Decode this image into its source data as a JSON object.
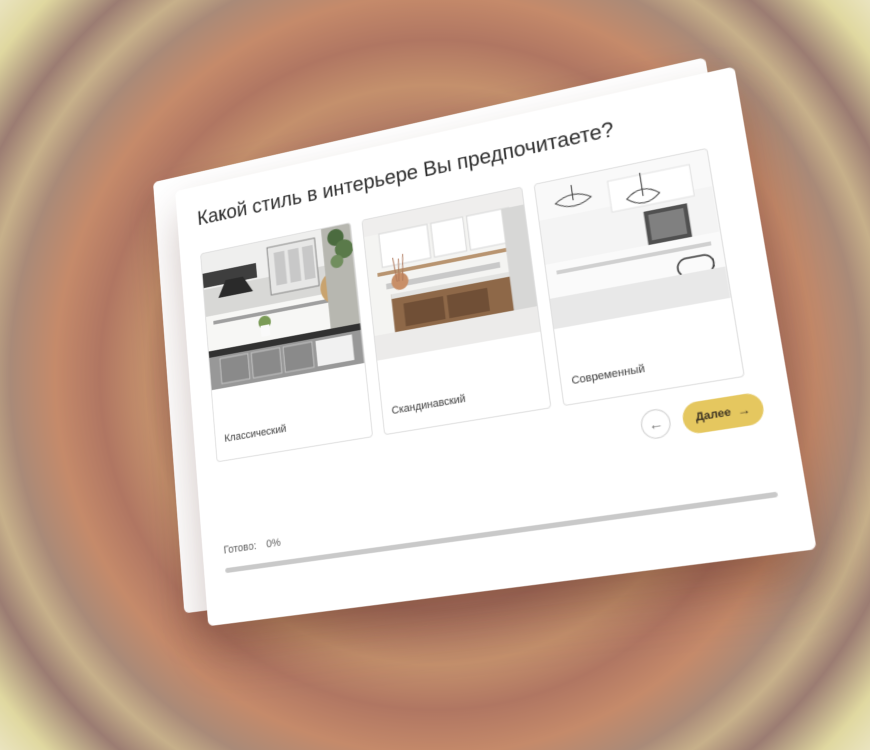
{
  "quiz": {
    "question": "Какой стиль в интерьере Вы предпочитаете?",
    "options": [
      {
        "label": "Классический"
      },
      {
        "label": "Скандинавский"
      },
      {
        "label": "Современный"
      }
    ],
    "navigation": {
      "back_icon": "←",
      "next_label": "Далее",
      "next_icon": "→"
    },
    "progress": {
      "label": "Готово:",
      "value_text": "0%",
      "value": 0
    }
  },
  "colors": {
    "accent": "#e5c75f",
    "text": "#2d2d2d",
    "border": "#dedede",
    "track": "#c9c9c9"
  }
}
